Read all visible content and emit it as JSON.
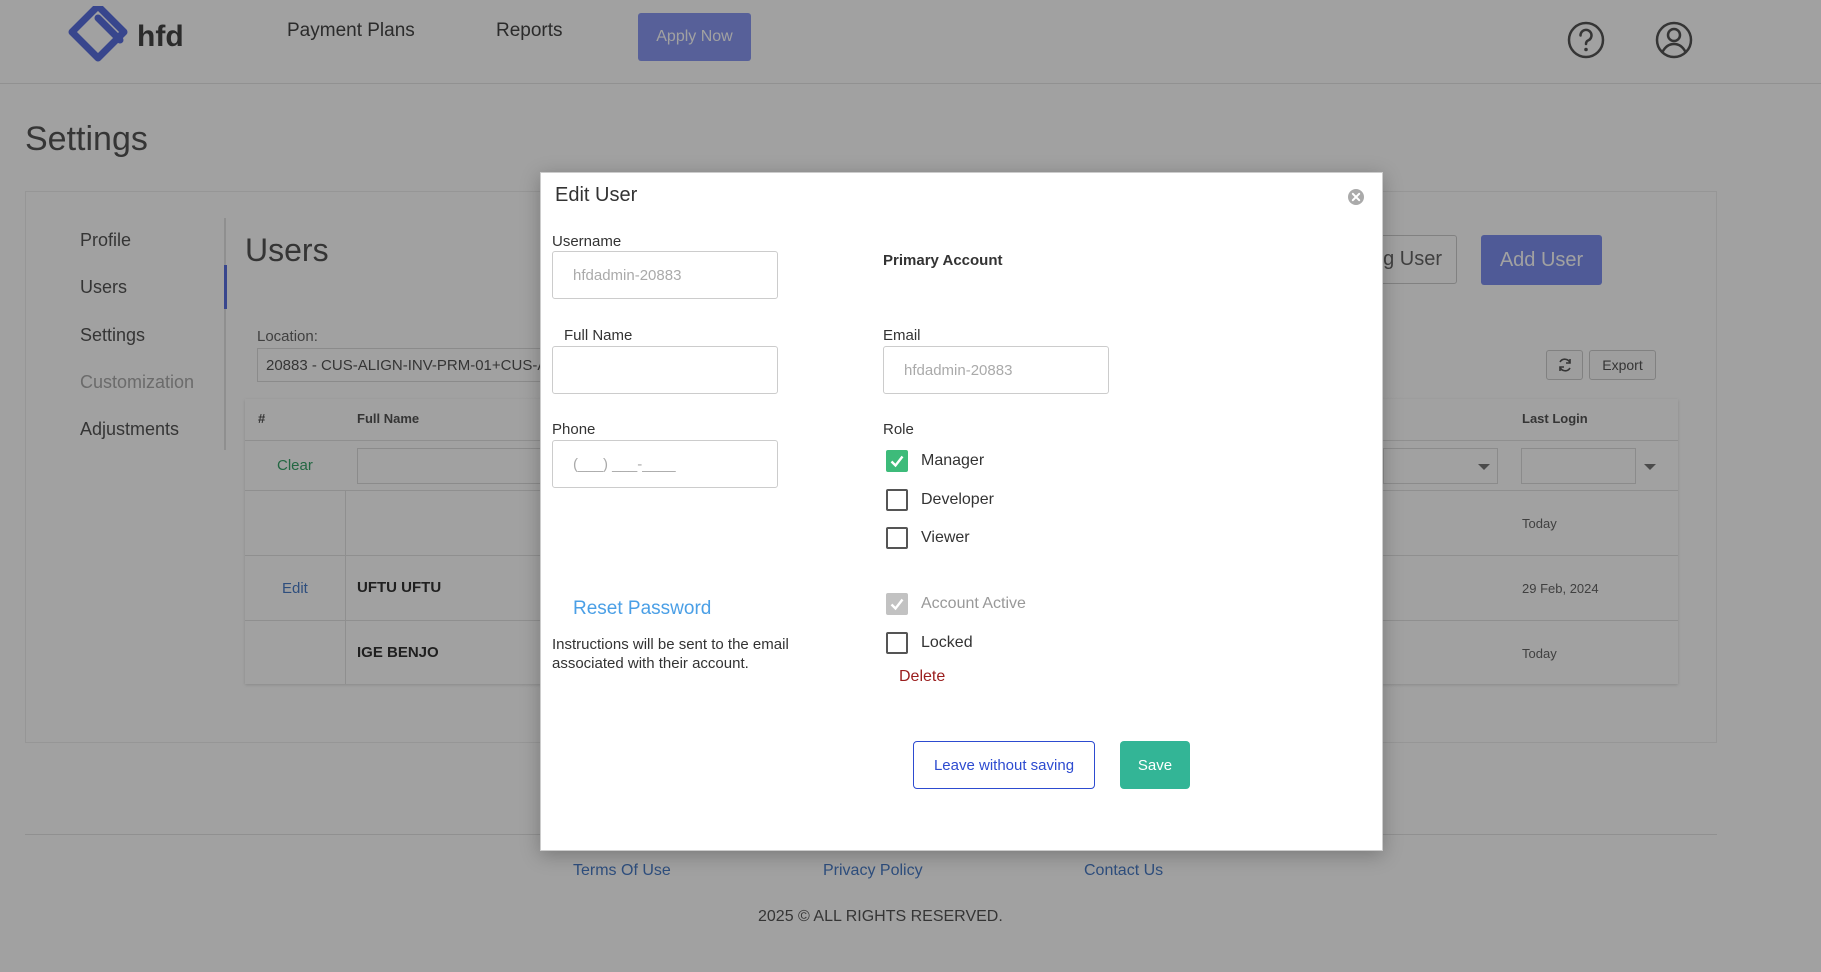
{
  "header": {
    "logo_text": "hfd",
    "nav": [
      "Payment Plans",
      "Reports"
    ],
    "apply_label": "Apply Now"
  },
  "page": {
    "title": "Settings",
    "sidebar": [
      "Profile",
      "Users",
      "Settings",
      "Customization",
      "Adjustments"
    ],
    "users_title": "Users",
    "partial_button_label": "g User",
    "add_user_label": "Add User",
    "location_label": "Location:",
    "location_value": "20883 - CUS-ALIGN-INV-PRM-01+CUS-A",
    "export_label": "Export",
    "table": {
      "headers": [
        "#",
        "Full Name",
        "Last Login"
      ],
      "clear_label": "Clear",
      "rows": [
        {
          "action": "",
          "name": "",
          "last_login": "Today"
        },
        {
          "action": "Edit",
          "name": "UFTU UFTU",
          "last_login": "29 Feb, 2024"
        },
        {
          "action": "",
          "name": "IGE BENJO",
          "last_login": "Today"
        }
      ]
    }
  },
  "footer": {
    "links": [
      "Terms Of Use",
      "Privacy Policy",
      "Contact Us"
    ],
    "copyright": "2025 © ALL RIGHTS RESERVED."
  },
  "modal": {
    "title": "Edit User",
    "username_label": "Username",
    "username_placeholder": "hfdadmin-20883",
    "primary_account_label": "Primary Account",
    "fullname_label": "Full Name",
    "fullname_value": "",
    "email_label": "Email",
    "email_placeholder": "hfdadmin-20883",
    "phone_label": "Phone",
    "phone_placeholder": "(___) ___-____",
    "role_label": "Role",
    "roles": [
      {
        "label": "Manager",
        "checked": true
      },
      {
        "label": "Developer",
        "checked": false
      },
      {
        "label": "Viewer",
        "checked": false
      }
    ],
    "reset_password_label": "Reset Password",
    "reset_help": "Instructions will be sent to the email associated with their account.",
    "account_active_label": "Account Active",
    "locked_label": "Locked",
    "delete_label": "Delete",
    "leave_label": "Leave without saving",
    "save_label": "Save"
  },
  "colors": {
    "accent": "#7e8ff0",
    "checkbox_checked": "#3dbb7a",
    "save": "#33b596",
    "link": "#4a9fe6",
    "danger": "#9a1d1d"
  }
}
